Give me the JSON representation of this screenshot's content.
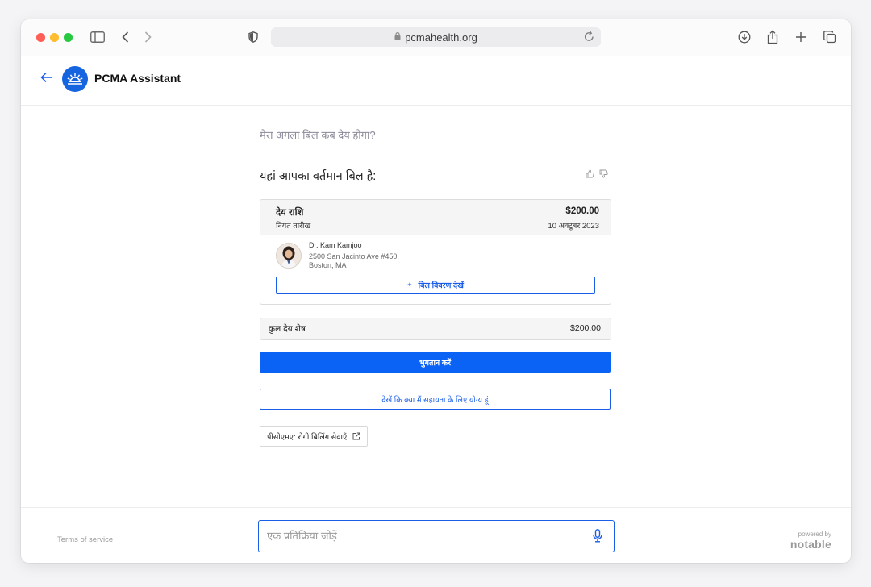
{
  "browser": {
    "url": "pcmahealth.org"
  },
  "header": {
    "title": "PCMA Assistant"
  },
  "chat": {
    "question": "मेरा अगला बिल कब देय होगा?",
    "answer": "यहां आपका वर्तमान बिल है:"
  },
  "bill": {
    "due_label": "देय राशि",
    "due_amount": "$200.00",
    "due_date_label": "नियत तारीख",
    "due_date": "10 अक्टूबर 2023",
    "doctor_name": "Dr. Kam Kamjoo",
    "address_line1": "2500 San Jacinto Ave #450,",
    "address_line2": "Boston, MA",
    "details_plus": "+",
    "details_label": "बिल विवरण देखें"
  },
  "balance": {
    "label": "कुल देय शेष",
    "value": "$200.00"
  },
  "actions": {
    "pay_label": "भुगतान करें",
    "assistance_label": "देखें कि क्या मैं सहायता के लिए योग्य हूं",
    "link_label": "पीसीएमए: रोगी बिलिंग सेवाएँ"
  },
  "footer": {
    "terms": "Terms of service",
    "input_placeholder": "एक प्रतिक्रिया जोड़ें",
    "powered_by": "powered by",
    "brand": "notable"
  },
  "colors": {
    "accent": "#0b63f6",
    "link": "#1a5ee8"
  }
}
